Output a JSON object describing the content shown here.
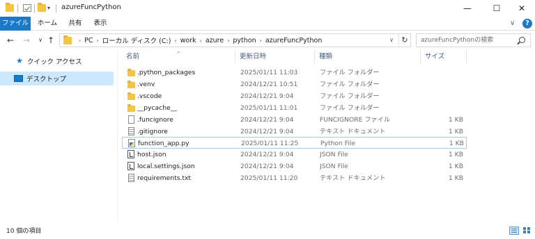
{
  "window": {
    "title": "azureFuncPython",
    "minimize_glyph": "—",
    "maximize_glyph": "☐",
    "close_glyph": "✕",
    "qa_dropdown_glyph": "▾"
  },
  "ribbon": {
    "tabs": [
      {
        "label": "ファイル"
      },
      {
        "label": "ホーム"
      },
      {
        "label": "共有"
      },
      {
        "label": "表示"
      }
    ],
    "collapse_glyph": "∨",
    "help_glyph": "?",
    "accent_color": "#1979ca"
  },
  "navigation": {
    "back_glyph": "←",
    "forward_glyph": "→",
    "recent_glyph": "∨",
    "up_glyph": "↑",
    "separator_glyph": "›",
    "breadcrumbs": [
      "PC",
      "ローカル ディスク (C:)",
      "work",
      "azure",
      "python",
      "azureFuncPython"
    ],
    "dropdown_glyph": "∨",
    "refresh_glyph": "↻"
  },
  "search": {
    "placeholder": "azureFuncPythonの検索",
    "icon": "search-icon"
  },
  "nav_pane": {
    "items": [
      {
        "label": "クイック アクセス",
        "icon": "star-icon",
        "selected": false
      },
      {
        "label": "デスクトップ",
        "icon": "desktop-icon",
        "selected": true
      }
    ]
  },
  "file_list": {
    "columns": {
      "name": "名前",
      "date": "更新日時",
      "type": "種類",
      "size": "サイズ"
    },
    "sort_glyph": "^",
    "files": [
      {
        "name": ".python_packages",
        "date": "2025/01/11 11:03",
        "type": "ファイル フォルダー",
        "size": "",
        "icon": "folder-icon"
      },
      {
        "name": ".venv",
        "date": "2024/12/21 10:51",
        "type": "ファイル フォルダー",
        "size": "",
        "icon": "folder-icon"
      },
      {
        "name": ".vscode",
        "date": "2024/12/21 9:04",
        "type": "ファイル フォルダー",
        "size": "",
        "icon": "folder-icon"
      },
      {
        "name": "__pycache__",
        "date": "2025/01/11 11:01",
        "type": "ファイル フォルダー",
        "size": "",
        "icon": "folder-icon"
      },
      {
        "name": ".funcignore",
        "date": "2024/12/21 9:04",
        "type": "FUNCIGNORE ファイル",
        "size": "1 KB",
        "icon": "file-icon"
      },
      {
        "name": ".gitignore",
        "date": "2024/12/21 9:04",
        "type": "テキスト ドキュメント",
        "size": "1 KB",
        "icon": "text-file-icon"
      },
      {
        "name": "function_app.py",
        "date": "2025/01/11 11:25",
        "type": "Python File",
        "size": "1 KB",
        "icon": "python-file-icon",
        "selected": true
      },
      {
        "name": "host.json",
        "date": "2024/12/21 9:04",
        "type": "JSON File",
        "size": "1 KB",
        "icon": "json-file-icon"
      },
      {
        "name": "local.settings.json",
        "date": "2024/12/21 9:04",
        "type": "JSON File",
        "size": "1 KB",
        "icon": "json-file-icon"
      },
      {
        "name": "requirements.txt",
        "date": "2025/01/11 11:20",
        "type": "テキスト ドキュメント",
        "size": "1 KB",
        "icon": "text-file-icon"
      }
    ]
  },
  "status": {
    "item_count": "10 個の項目"
  }
}
